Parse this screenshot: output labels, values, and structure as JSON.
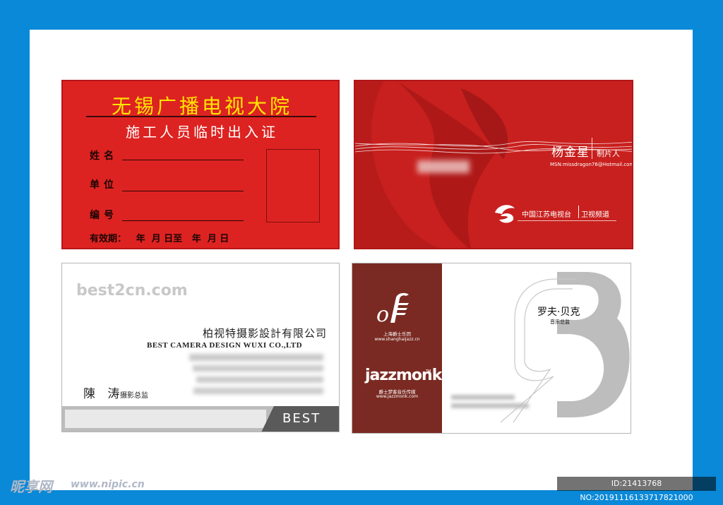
{
  "pass_card": {
    "title": "无锡广播电视大院",
    "subtitle": "施工人员临时出入证",
    "label_name": "姓名",
    "label_unit": "单位",
    "label_number": "编号",
    "validity": "有效期：   年  月 日至   年  月 日"
  },
  "red_card": {
    "name": "杨金星",
    "role": "制片人",
    "msn": "MSN:missdragon76@Hotmail.com",
    "org1": "中国江苏电视台",
    "org2": "卫视频道"
  },
  "best_card": {
    "website": "best2cn.com",
    "company_cn": "柏视特摄影設計有限公司",
    "company_en": "BEST CAMERA DESIGN WUXI CO.,LTD",
    "name": "陳 涛",
    "role": "摄影总监",
    "brand": "BEST"
  },
  "jazz_card": {
    "group_cn": "上海爵士乐团",
    "group_web": "www.shanghaijazz.cn",
    "brand": "jazzmonk",
    "tm": "TM",
    "media_cn": "爵士梦客音乐传媒",
    "media_web": "www.jazzmonk.com",
    "name": "罗夫·贝克",
    "role": "音乐总监"
  },
  "watermark": {
    "logo": "昵享网",
    "site": "www.nipic.cn",
    "id_text": "ID:21413768 NO:20191116133717821000"
  },
  "colors": {
    "frame": "#0a89d8",
    "red": "#dd2321",
    "dark_red": "#7a2a22",
    "yellow": "#ffe600"
  }
}
